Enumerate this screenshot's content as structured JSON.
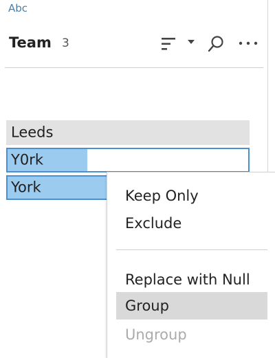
{
  "field": {
    "type_label": "Abc",
    "name": "Team",
    "count": "3"
  },
  "toolbar": {
    "sort_icon": "sort-bars-icon",
    "dropdown_icon": "caret-down-icon",
    "search_icon": "search-icon",
    "more_icon": "more-options-icon"
  },
  "values": [
    {
      "label": "Leeds",
      "selected": false,
      "bar_fraction": 0.0
    },
    {
      "label": "Y0rk",
      "selected": true,
      "bar_fraction": 0.33
    },
    {
      "label": "York",
      "selected": true,
      "bar_fraction": 0.41
    }
  ],
  "context_menu": {
    "items": [
      {
        "label": "Keep Only",
        "state": "normal"
      },
      {
        "label": "Exclude",
        "state": "normal"
      },
      {
        "label": "Replace with Null",
        "state": "normal"
      },
      {
        "label": "Group",
        "state": "highlighted"
      },
      {
        "label": "Ungroup",
        "state": "disabled"
      }
    ]
  },
  "colors": {
    "type_label": "#4a7fa8",
    "selection_border": "#4a8fd0",
    "selection_bar": "#9ccbf0",
    "row_background": "#e2e2e2",
    "menu_highlight": "#d9d9d9",
    "disabled_text": "#ababab"
  }
}
